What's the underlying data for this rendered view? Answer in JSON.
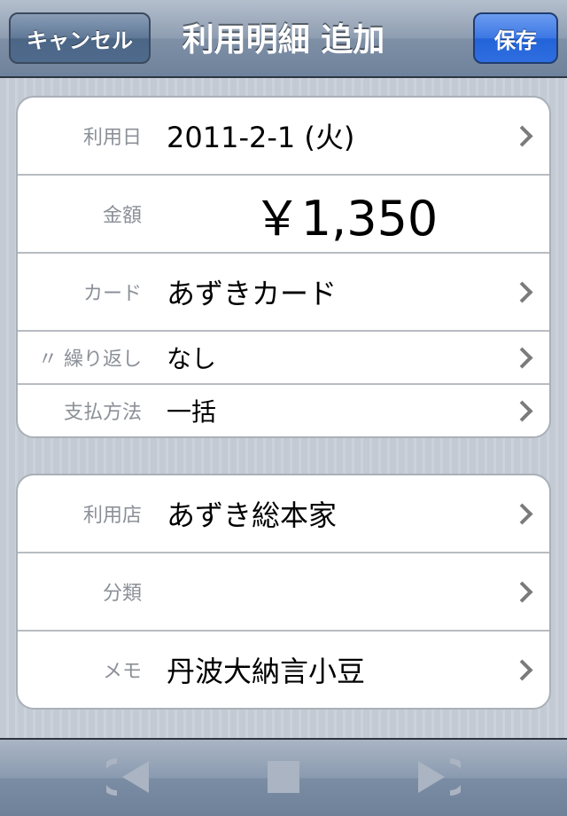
{
  "navbar": {
    "cancel_label": "キャンセル",
    "title": "利用明細 追加",
    "save_label": "保存"
  },
  "group1": {
    "rows": [
      {
        "label": "利用日",
        "value": "2011-2-1 (火)"
      },
      {
        "label": "金額",
        "value": "￥1,350"
      },
      {
        "label": "カード",
        "value": "あずきカード"
      },
      {
        "label": "〃 繰り返し",
        "value": "なし"
      },
      {
        "label": "支払方法",
        "value": "一括"
      }
    ]
  },
  "group2": {
    "rows": [
      {
        "label": "利用店",
        "value": "あずき総本家"
      },
      {
        "label": "分類",
        "value": ""
      },
      {
        "label": "メモ",
        "value": "丹波大納言小豆"
      }
    ]
  },
  "toolbar": {
    "items": [
      "rewind-icon",
      "stop-icon",
      "fast-forward-icon"
    ]
  },
  "colors": {
    "save_button": "#2f6ee0",
    "nav_bar": "#8e9db1",
    "disabled_icon": "#aab4c2"
  }
}
